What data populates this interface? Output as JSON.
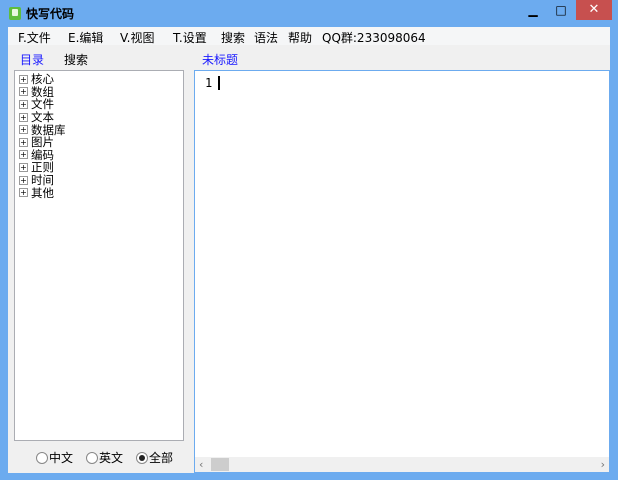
{
  "window": {
    "title": "快写代码",
    "minimize": "▁",
    "maximize": "□",
    "close": "✕"
  },
  "menu": [
    "F.文件",
    "E.编辑",
    "V.视图",
    "T.设置",
    "搜索",
    "语法",
    "帮助",
    "QQ群:233098064"
  ],
  "left_tabs": {
    "catalog": "目录",
    "search": "搜索"
  },
  "editor_tab": "未标题",
  "tree": [
    "核心",
    "数组",
    "文件",
    "文本",
    "数据库",
    "图片",
    "编码",
    "正则",
    "时间",
    "其他"
  ],
  "radios": [
    {
      "label": "中文",
      "checked": false
    },
    {
      "label": "英文",
      "checked": false
    },
    {
      "label": "全部",
      "checked": true
    }
  ],
  "editor": {
    "line_number": "1"
  },
  "colors": {
    "tab_active": "#1a1aff",
    "window_border": "#6cabef",
    "close": "#c7504f"
  }
}
